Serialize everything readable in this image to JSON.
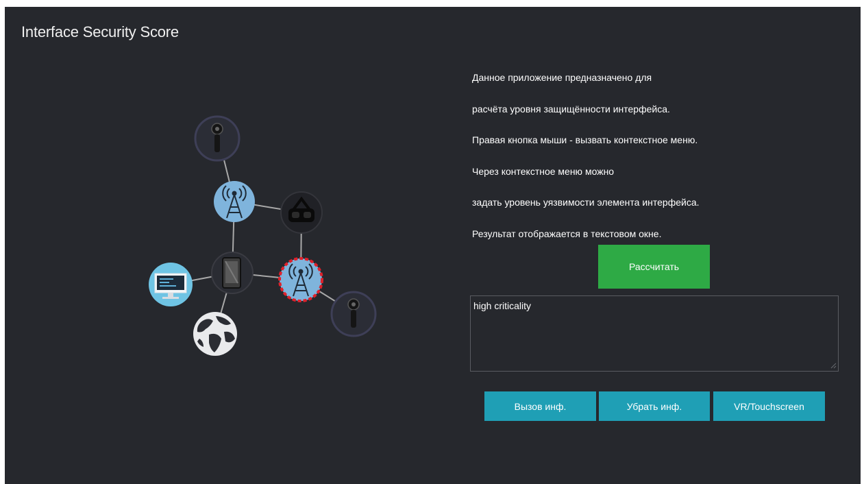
{
  "app": {
    "title": "Interface Security Score"
  },
  "info": {
    "lines": [
      "Данное приложение предназначено для",
      "расчёта уровня защищённости интерфейса.",
      "Правая кнопка мыши - вызвать контекстное меню.",
      "Через контекстное меню можно",
      "задать уровень уязвимости элемента интерфейса.",
      "Результат отображается в текстовом окне."
    ]
  },
  "actions": {
    "calculate_label": "Рассчитать",
    "show_info_label": "Вызов инф.",
    "hide_info_label": "Убрать инф.",
    "vr_label": "VR/Touchscreen"
  },
  "result": {
    "value": "high criticality"
  },
  "graph": {
    "nodes": [
      {
        "id": "sensor-top",
        "icon": "sensor-icon"
      },
      {
        "id": "tower-top",
        "icon": "radio-tower-icon"
      },
      {
        "id": "vr-headset",
        "icon": "vr-headset-icon"
      },
      {
        "id": "tablet-hub",
        "icon": "tablet-icon"
      },
      {
        "id": "tower-critical",
        "icon": "radio-tower-icon",
        "status": "critical"
      },
      {
        "id": "monitor",
        "icon": "monitor-icon"
      },
      {
        "id": "sensor-right",
        "icon": "sensor-icon"
      },
      {
        "id": "globe",
        "icon": "globe-icon"
      }
    ]
  },
  "colors": {
    "background": "#26282d",
    "calculate_button": "#2eaa45",
    "action_buttons": "#1f9fb5",
    "node_light_blue": "#7fb4dc",
    "critical_border": "#e0202a",
    "edge": "#a9a9a9"
  }
}
